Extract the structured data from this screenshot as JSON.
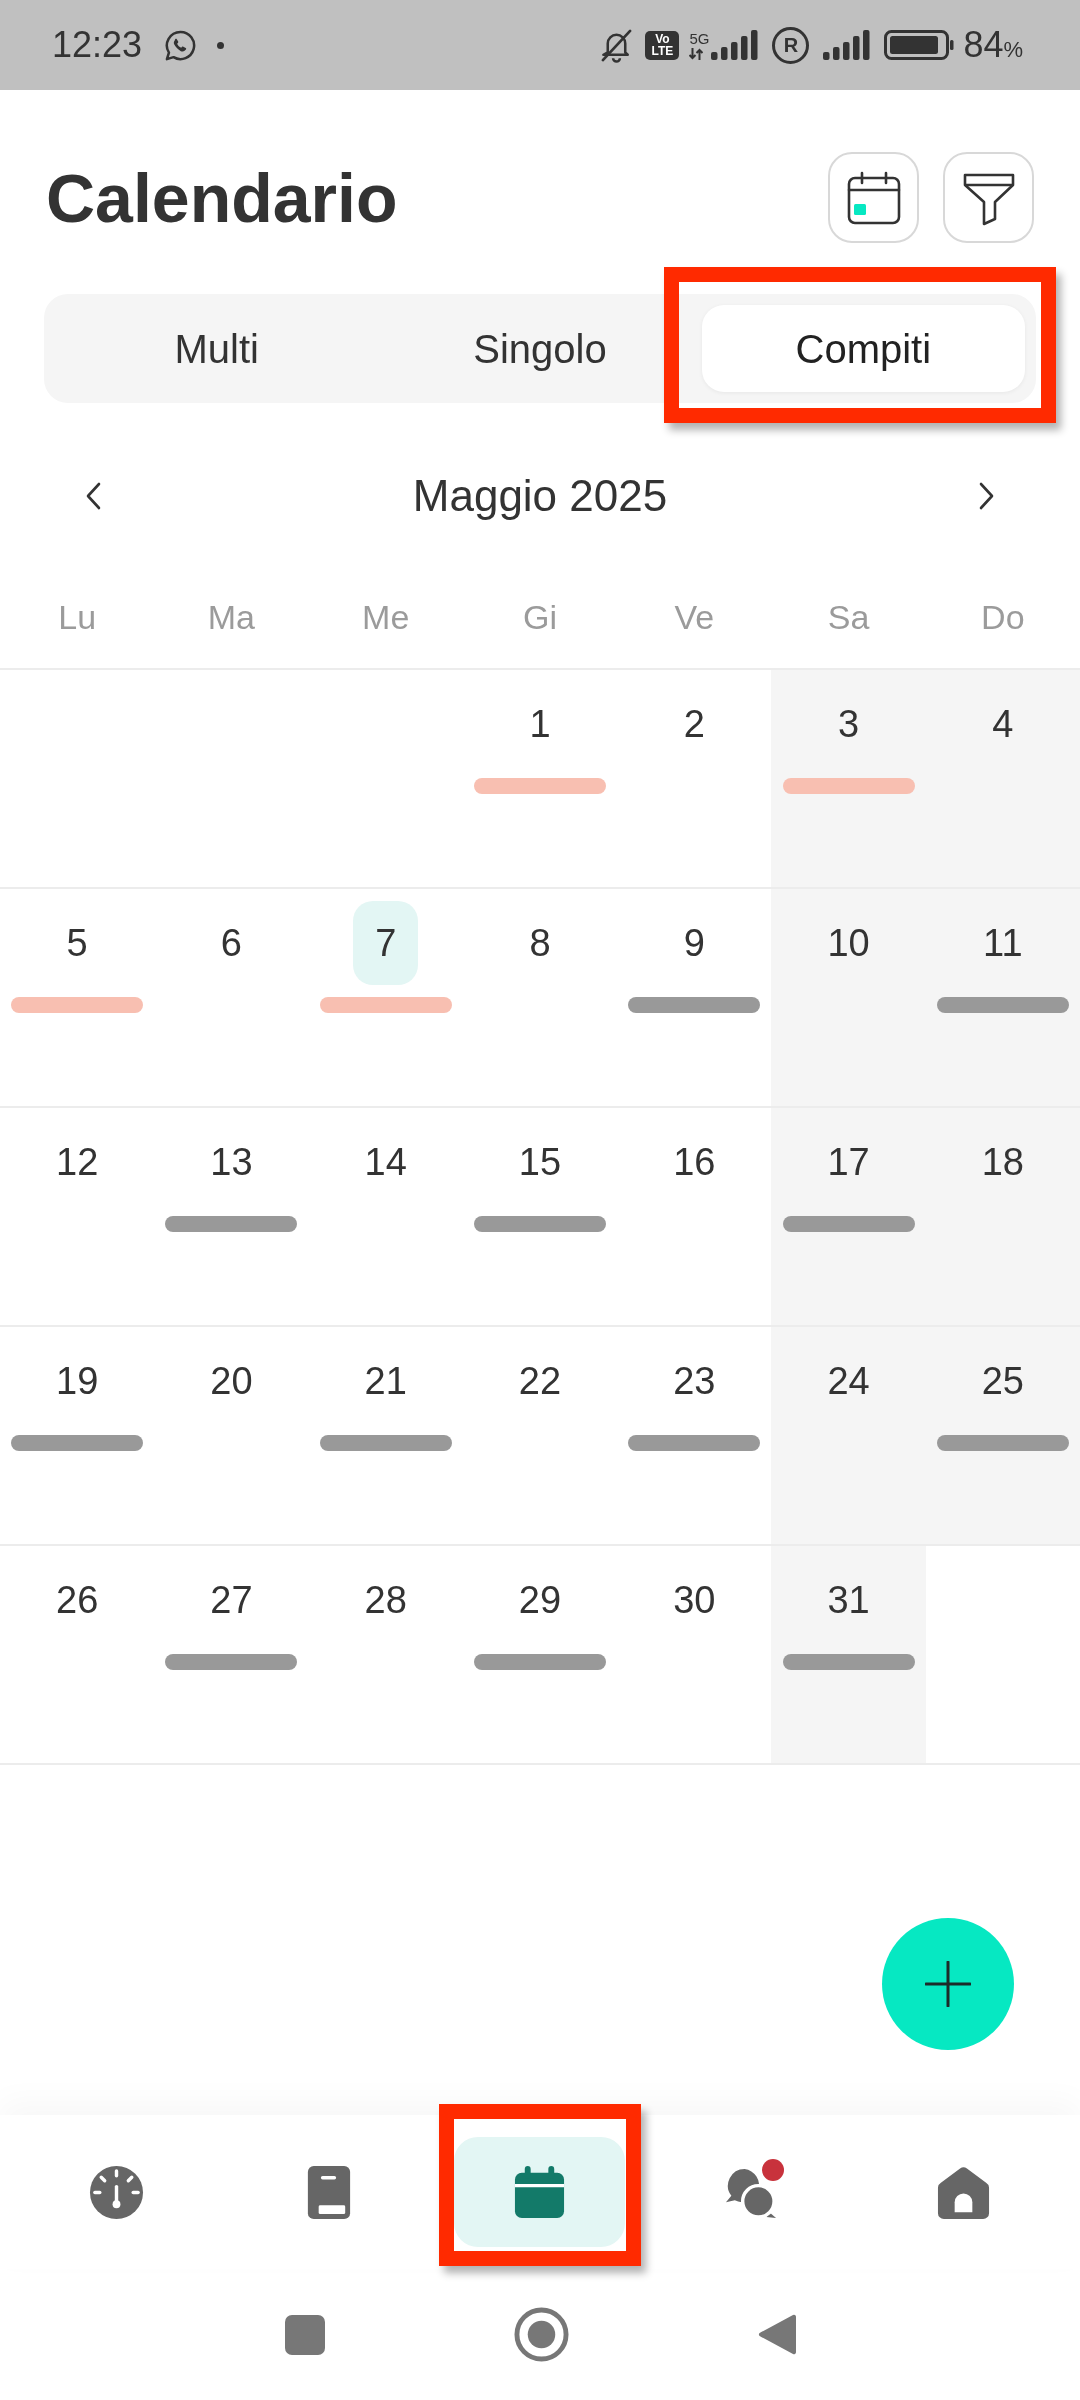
{
  "status_bar": {
    "time": "12:23",
    "volte": [
      "Vo",
      "LTE"
    ],
    "network": "5G",
    "roaming": "R",
    "battery": "84",
    "battery_unit": "%"
  },
  "header": {
    "title": "Calendario",
    "actions": [
      {
        "kind": "calendar"
      },
      {
        "kind": "filter"
      }
    ]
  },
  "tabs": [
    {
      "label": "Multi",
      "selected": false,
      "highlighted": false
    },
    {
      "label": "Singolo",
      "selected": false,
      "highlighted": false
    },
    {
      "label": "Compiti",
      "selected": true,
      "highlighted": true
    }
  ],
  "month_nav": {
    "title": "Maggio 2025"
  },
  "weekdays": [
    "Lu",
    "Ma",
    "Me",
    "Gi",
    "Ve",
    "Sa",
    "Do"
  ],
  "weeks": [
    [
      {
        "kind": "blank"
      },
      {
        "kind": "blank"
      },
      {
        "kind": "blank"
      },
      {
        "kind": "day",
        "day": "1",
        "weekend": false,
        "today": false,
        "color": "#f8bfb1"
      },
      {
        "kind": "day",
        "day": "2",
        "weekend": false,
        "today": false
      },
      {
        "kind": "day",
        "day": "3",
        "weekend": true,
        "today": false,
        "color": "#f8bfb1"
      },
      {
        "kind": "day",
        "day": "4",
        "weekend": true,
        "today": false
      }
    ],
    [
      {
        "kind": "day",
        "day": "5",
        "weekend": false,
        "today": false,
        "color": "#f8bfb1"
      },
      {
        "kind": "day",
        "day": "6",
        "weekend": false,
        "today": false
      },
      {
        "kind": "day",
        "day": "7",
        "weekend": false,
        "today": true,
        "color": "#f8bfb1"
      },
      {
        "kind": "day",
        "day": "8",
        "weekend": false,
        "today": false
      },
      {
        "kind": "day",
        "day": "9",
        "weekend": false,
        "today": false,
        "color": "#999999"
      },
      {
        "kind": "day",
        "day": "10",
        "weekend": true,
        "today": false
      },
      {
        "kind": "day",
        "day": "11",
        "weekend": true,
        "today": false,
        "color": "#999999"
      }
    ],
    [
      {
        "kind": "day",
        "day": "12",
        "weekend": false,
        "today": false
      },
      {
        "kind": "day",
        "day": "13",
        "weekend": false,
        "today": false,
        "color": "#999999"
      },
      {
        "kind": "day",
        "day": "14",
        "weekend": false,
        "today": false
      },
      {
        "kind": "day",
        "day": "15",
        "weekend": false,
        "today": false,
        "color": "#999999"
      },
      {
        "kind": "day",
        "day": "16",
        "weekend": false,
        "today": false
      },
      {
        "kind": "day",
        "day": "17",
        "weekend": true,
        "today": false,
        "color": "#999999"
      },
      {
        "kind": "day",
        "day": "18",
        "weekend": true,
        "today": false
      }
    ],
    [
      {
        "kind": "day",
        "day": "19",
        "weekend": false,
        "today": false,
        "color": "#999999"
      },
      {
        "kind": "day",
        "day": "20",
        "weekend": false,
        "today": false
      },
      {
        "kind": "day",
        "day": "21",
        "weekend": false,
        "today": false,
        "color": "#999999"
      },
      {
        "kind": "day",
        "day": "22",
        "weekend": false,
        "today": false
      },
      {
        "kind": "day",
        "day": "23",
        "weekend": false,
        "today": false,
        "color": "#999999"
      },
      {
        "kind": "day",
        "day": "24",
        "weekend": true,
        "today": false
      },
      {
        "kind": "day",
        "day": "25",
        "weekend": true,
        "today": false,
        "color": "#999999"
      }
    ],
    [
      {
        "kind": "day",
        "day": "26",
        "weekend": false,
        "today": false
      },
      {
        "kind": "day",
        "day": "27",
        "weekend": false,
        "today": false,
        "color": "#999999"
      },
      {
        "kind": "day",
        "day": "28",
        "weekend": false,
        "today": false
      },
      {
        "kind": "day",
        "day": "29",
        "weekend": false,
        "today": false,
        "color": "#999999"
      },
      {
        "kind": "day",
        "day": "30",
        "weekend": false,
        "today": false
      },
      {
        "kind": "day",
        "day": "31",
        "weekend": true,
        "today": false,
        "color": "#999999"
      },
      {
        "kind": "blank"
      }
    ]
  ],
  "bottom_nav": [
    {
      "kind": "dashboard",
      "selected": false,
      "highlighted": false,
      "badge": false
    },
    {
      "kind": "book",
      "selected": false,
      "highlighted": false,
      "badge": false
    },
    {
      "kind": "calendar",
      "selected": true,
      "highlighted": true,
      "badge": false
    },
    {
      "kind": "chat",
      "selected": false,
      "highlighted": false,
      "badge": true
    },
    {
      "kind": "home",
      "selected": false,
      "highlighted": false,
      "badge": false
    }
  ]
}
